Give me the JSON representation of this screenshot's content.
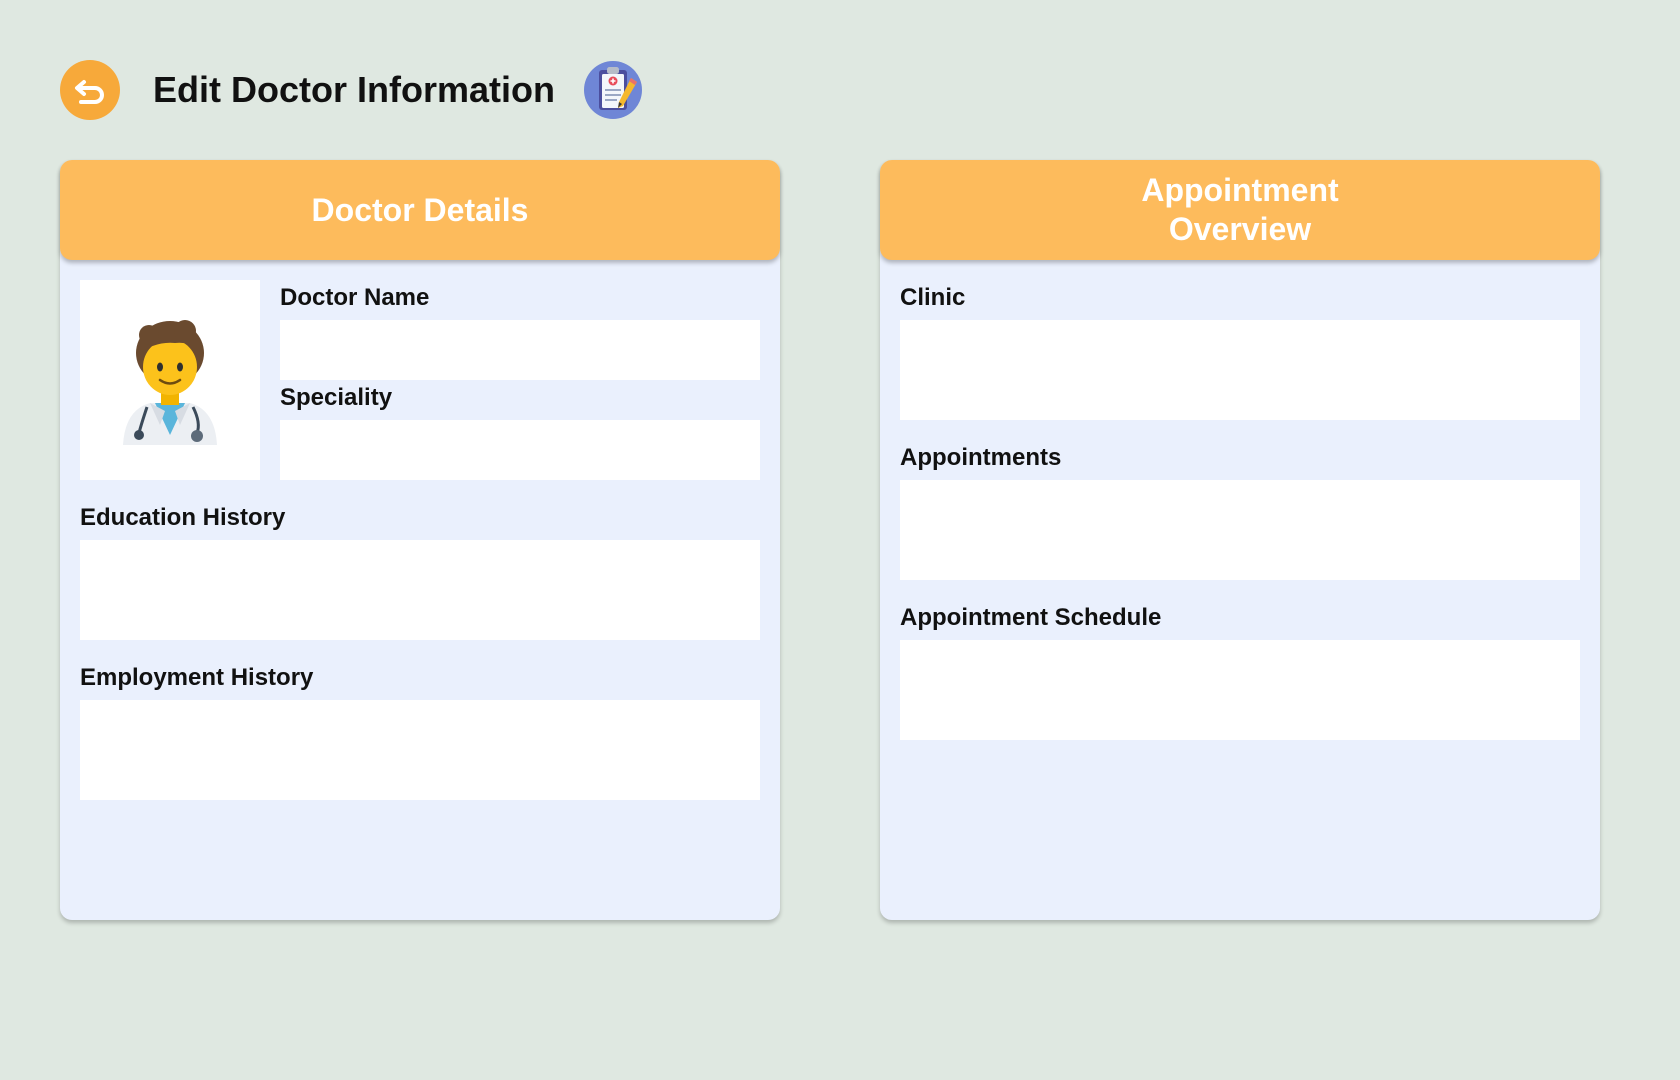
{
  "header": {
    "title": "Edit Doctor Information",
    "back_icon": "back-arrow-icon",
    "title_icon": "clipboard-icon"
  },
  "colors": {
    "background": "#DFE8E1",
    "accent": "#F7A93A",
    "card_header": "#FDBB5C",
    "card_body": "#EAF0FD",
    "field": "#FFFFFF"
  },
  "doctor_details": {
    "title": "Doctor Details",
    "avatar_icon": "doctor-avatar-icon",
    "fields": {
      "name_label": "Doctor Name",
      "speciality_label": "Speciality",
      "education_label": "Education History",
      "employment_label": "Employment History"
    }
  },
  "appointment_overview": {
    "title": "Appointment Overview",
    "fields": {
      "clinic_label": "Clinic",
      "appointments_label": "Appointments",
      "schedule_label": "Appointment Schedule"
    }
  }
}
